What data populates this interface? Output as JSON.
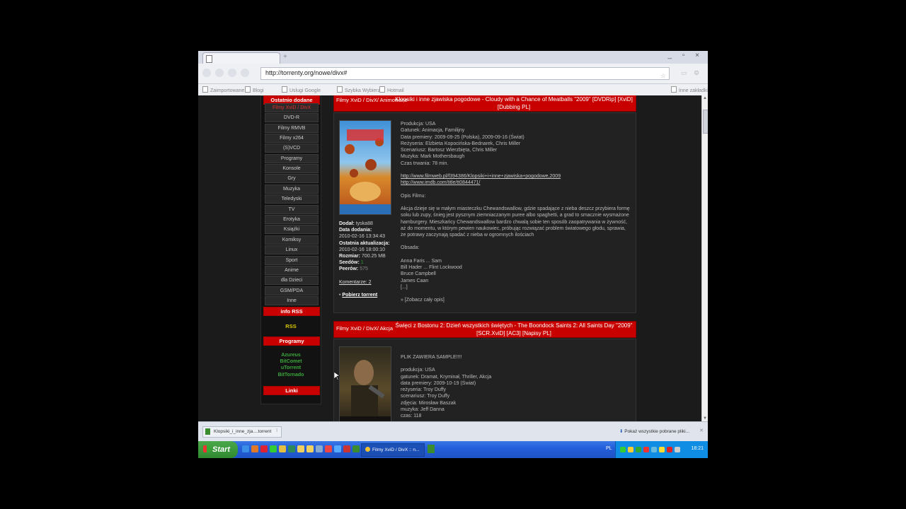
{
  "browser": {
    "url": "http://torrenty.org/nowe/divx#",
    "bookmarks": [
      "Zaimportowane",
      "Blogi",
      "Uslugi Google",
      "Szybka Wybierz",
      "Hotmail"
    ],
    "other_bookmarks": "Inne zakładki"
  },
  "sidebar": {
    "header_new": "Ostatnio dodane",
    "items": [
      "Filmy XviD / DivX",
      "DVD-R",
      "Filmy RMVB",
      "Filmy x264",
      "(S)VCD",
      "Programy",
      "Konsole",
      "Gry",
      "Muzyka",
      "Teledyski",
      "TV",
      "Erotyka",
      "Książki",
      "Komiksy",
      "Linux",
      "Sport",
      "Anime",
      "dla Dzieci",
      "GSM/PDA",
      "Inne"
    ],
    "info_rss_header": "info RSS",
    "rss": "RSS",
    "programs_header": "Programy",
    "programs": [
      "Azureus",
      "BitComet",
      "uTorrent",
      "BitTornado"
    ],
    "links_header": "Linki"
  },
  "torrents": [
    {
      "category": "Filmy XviD / DivX/ Animowane",
      "title": "Klopsiki i inne zjawiska pogodowe - Cloudy with a Chance of Meatballs \"2009\" [DVDRip] [XviD] [Dubbing PL]",
      "added_by_label": "Dodał:",
      "added_by": "tyska88",
      "date_added_label": "Data dodania:",
      "date_added": "2010-02-16 13:34:43",
      "last_update_label": "Ostatnia aktualizacja:",
      "last_update": "2010-02-16 18:00:10",
      "size_label": "Rozmiar:",
      "size": "700.25 MB",
      "seeds_label": "Seedów:",
      "seeds": "1",
      "peers_label": "Peerów:",
      "peers": "575",
      "comments": "Komentarze: 2",
      "download": "Pobierz torrent",
      "info_lines": [
        "Produkcja: USA",
        "Gatunek: Animacja, Familijny",
        "Data premiery: 2009-09-25 (Polska), 2009-09-16 (Świat)",
        "Reżyseria: Elżbieta Kopocińska-Bednarek, Chris Miller",
        "Scenariusz: Bartosz Wierzbięta, Chris Miller",
        "Muzyka: Mark Mothersbaugh",
        "Czas trwania: 78 min."
      ],
      "links": [
        "http://www.filmweb.pl/f394386/Klopsiki+i+inne+zjawiska+pogodowe,2009",
        "http://www.imdb.com/title/tt0844471/"
      ],
      "description_label": "Opis Filmu:",
      "description": "Akcja dzieje się w małym miasteczku Chewandswallow, gdzie spadające z nieba deszcz przybiera formę soku lub zupy, śnieg jest pysznym ziemniaczanym puree albo spaghetti, a grad to smacznie wysmażone hamburgery. Mieszkańcy Chewandswallow bardzo chwalą sobie ten sposób zaopatrywania w żywność, aż do momentu, w którym pewien naukowiec, próbując rozwiązać problem światowego głodu, sprawia, że potrawy zaczynają spadać z nieba w ogromnych ilościach",
      "cast_label": "Obsada:",
      "cast": [
        "Anna Faris ... Sam",
        "Bill Hader ... Flint Lockwood",
        "Bruce Campbell",
        "James Caan",
        "[...]"
      ],
      "see_full": "» [Zobacz cały opis]"
    },
    {
      "category": "Filmy XviD / DivX/ Akcja",
      "title": "Święci z Bostonu 2: Dzień wszystkich świętych - The Boondock Saints 2: All Saints Day \"2009\" [SCR.XviD] [AC3] [Napisy PL]",
      "info_lines": [
        "PLIK ZAWIERA SAMPLE!!!!",
        "",
        "produkcja: USA",
        "gatunek: Dramat, Kryminał, Thriller, Akcja",
        "data premiery: 2009-10-19 (Świat)",
        "reżyseria: Troy Duffy",
        "scenariusz: Troy Duffy",
        "zdjęcia: Mirosław Baszak",
        "muzyka: Jeff Danna",
        "czas: 118"
      ]
    }
  ],
  "download_bar": {
    "file": "Klopsiki_i_inne_zja....torrent",
    "show_all": "Pokaż wszystkie pobrane pliki..."
  },
  "taskbar": {
    "start": "Start",
    "task": "Filmy XviD / DivX :: n...",
    "lang": "PL",
    "clock": "18:21"
  },
  "colors": {
    "accent_red": "#c80000",
    "rss_yellow": "#d6c600",
    "program_green": "#3ba63b"
  }
}
